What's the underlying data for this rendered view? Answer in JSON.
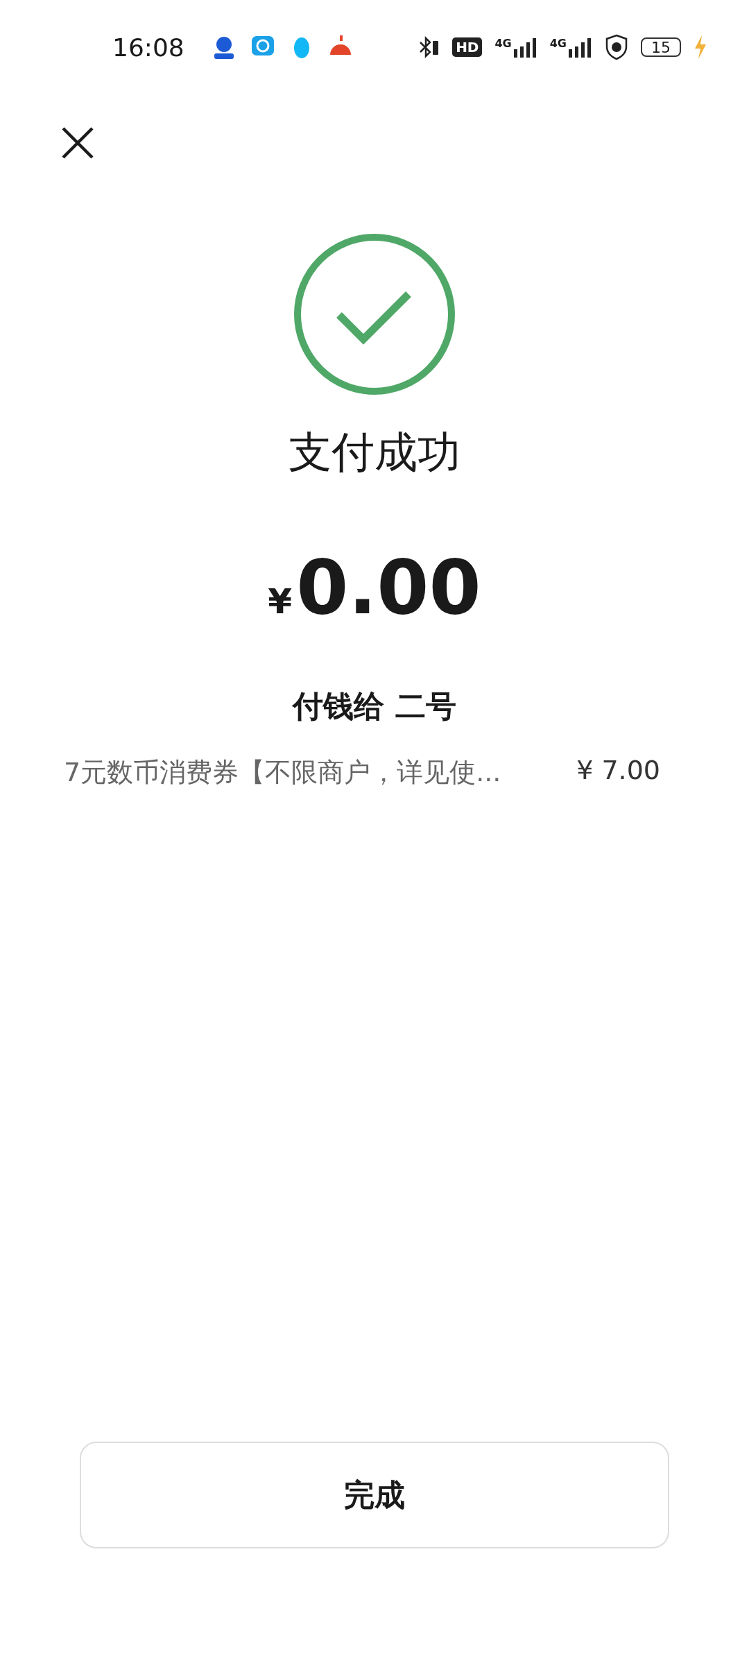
{
  "status_bar": {
    "time": "16:08",
    "hd_label": "HD",
    "network_labels": [
      "4G",
      "4G"
    ],
    "battery": "15",
    "charging": true
  },
  "title": "支付成功",
  "amount": {
    "currency": "¥",
    "value": "0.00"
  },
  "payee": "付钱给 二号",
  "items": [
    {
      "name": "7元数币消费券【不限商户，详见使...",
      "price": "¥ 7.00"
    }
  ],
  "done_button": "完成"
}
